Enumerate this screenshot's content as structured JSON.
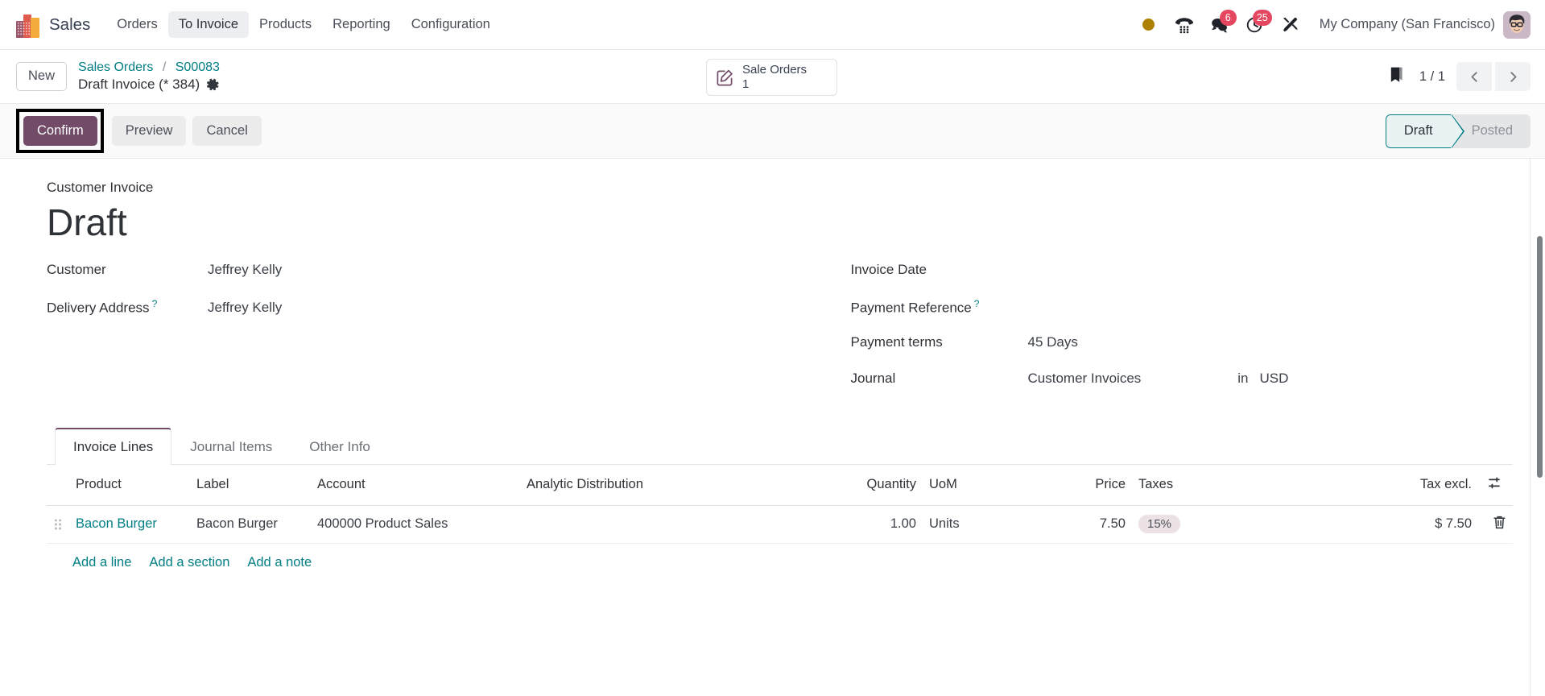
{
  "navbar": {
    "brand": "logo-odoo-sales",
    "app_name": "Sales",
    "menu": [
      {
        "label": "Orders",
        "active": false
      },
      {
        "label": "To Invoice",
        "active": true
      },
      {
        "label": "Products",
        "active": false
      },
      {
        "label": "Reporting",
        "active": false
      },
      {
        "label": "Configuration",
        "active": false
      }
    ],
    "systray": {
      "activity_dot": "activity-dot-icon",
      "voip_icon": "phone-keypad-icon",
      "messages_icon": "messages-icon",
      "messages_count": "6",
      "activities_icon": "clock-icon",
      "activities_count": "25",
      "debug_icon": "tools-icon"
    },
    "company": "My Company (San Francisco)",
    "avatar": "user-avatar"
  },
  "control_panel": {
    "new_label": "New",
    "breadcrumb": {
      "root": "Sales Orders",
      "separator": "/",
      "record": "S00083",
      "current": "Draft Invoice (* 384)",
      "gear_icon": "gear-icon"
    },
    "stat_button": {
      "icon": "pencil-square-icon",
      "label": "Sale Orders",
      "value": "1"
    },
    "bookmark_icon": "bookmark-icon",
    "pager": "1 / 1",
    "prev_icon": "chevron-left-icon",
    "next_icon": "chevron-right-icon"
  },
  "statusbar": {
    "confirm_label": "Confirm",
    "preview_label": "Preview",
    "cancel_label": "Cancel",
    "highlighted_button": "Confirm",
    "stages": [
      {
        "label": "Draft",
        "active": true
      },
      {
        "label": "Posted",
        "active": false
      }
    ]
  },
  "form": {
    "subtitle": "Customer Invoice",
    "title": "Draft",
    "left_fields": [
      {
        "label": "Customer",
        "value": "Jeffrey Kelly",
        "help": false
      },
      {
        "label": "Delivery Address",
        "value": "Jeffrey Kelly",
        "help": true
      }
    ],
    "right_fields": [
      {
        "label": "Invoice Date",
        "value": "",
        "help": false
      },
      {
        "label": "Payment Reference",
        "value": "",
        "help": true
      },
      {
        "label": "Payment terms",
        "value": "45 Days",
        "help": false
      }
    ],
    "journal": {
      "label": "Journal",
      "value": "Customer Invoices",
      "currency_sep": "in",
      "currency": "USD"
    }
  },
  "notebook": {
    "tabs": [
      {
        "label": "Invoice Lines",
        "active": true
      },
      {
        "label": "Journal Items",
        "active": false
      },
      {
        "label": "Other Info",
        "active": false
      }
    ],
    "columns": [
      "Product",
      "Label",
      "Account",
      "Analytic Distribution",
      "Quantity",
      "UoM",
      "Price",
      "Taxes",
      "Tax excl."
    ],
    "optional_columns_icon": "column-options-icon",
    "rows": [
      {
        "drag": "drag-handle-icon",
        "product": "Bacon Burger",
        "label": "Bacon Burger",
        "account": "400000 Product Sales",
        "analytic": "",
        "quantity": "1.00",
        "uom": "Units",
        "price": "7.50",
        "taxes": "15%",
        "tax_excl": "$ 7.50",
        "delete_icon": "trash-icon"
      }
    ],
    "add_links": [
      "Add a line",
      "Add a section",
      "Add a note"
    ]
  },
  "colors": {
    "primary": "#714B67",
    "link": "#017e84",
    "badge": "#e4475f",
    "activity_dot": "#ad8100",
    "tax_pill_bg": "#ece2e5",
    "stage_active_bg": "#e9f3f3"
  }
}
